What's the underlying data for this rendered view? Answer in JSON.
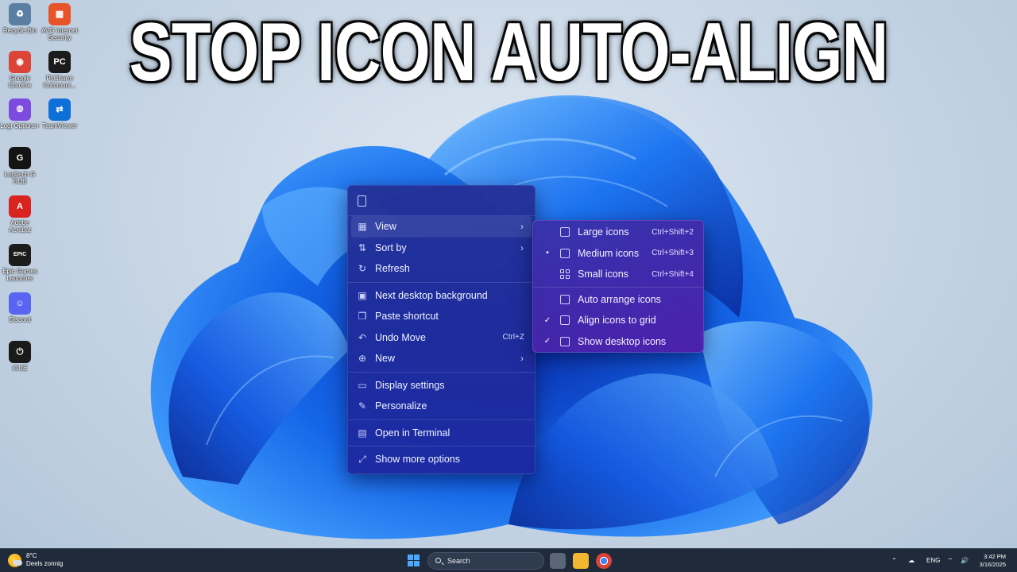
{
  "headline": "STOP ICON AUTO-ALIGN",
  "desktop_icons": [
    {
      "label": "Recycle Bin",
      "glyph": "♻",
      "color": "#5b7fa3"
    },
    {
      "label": "AVG Internet Security",
      "glyph": "▦",
      "color": "#e8542a"
    },
    {
      "label": "Google Chrome",
      "glyph": "◉",
      "color": "#db4437"
    },
    {
      "label": "PyCharm Communi...",
      "glyph": "PC",
      "color": "#1b1b1b"
    },
    {
      "label": "Logi Options+",
      "glyph": "⦾",
      "color": "#7d4be0"
    },
    {
      "label": "TeamViewer",
      "glyph": "⇄",
      "color": "#0e6fd8"
    },
    {
      "label": "Logitech G HUB",
      "glyph": "G",
      "color": "#141414"
    },
    {
      "label": "Adobe Acrobat",
      "glyph": "A",
      "color": "#d8231f"
    },
    {
      "label": "Epic Games Launcher",
      "glyph": "EPIC",
      "color": "#1c1c1c"
    },
    {
      "label": "Discord",
      "glyph": "☺",
      "color": "#5865f2"
    },
    {
      "label": "iCUE",
      "glyph": "⏻",
      "color": "#1a1a1a"
    }
  ],
  "context_menu": {
    "items": [
      {
        "label": "View",
        "icon": "grid-icon",
        "glyph": "▦",
        "arrow": "›",
        "hover": true
      },
      {
        "label": "Sort by",
        "icon": "sort-icon",
        "glyph": "⇅",
        "arrow": "›"
      },
      {
        "label": "Refresh",
        "icon": "refresh-icon",
        "glyph": "↻"
      },
      {
        "sep": true
      },
      {
        "label": "Next desktop background",
        "icon": "wallpaper-icon",
        "glyph": "▣"
      },
      {
        "label": "Paste shortcut",
        "icon": "paste-icon",
        "glyph": "❐"
      },
      {
        "label": "Undo Move",
        "icon": "undo-icon",
        "glyph": "↶",
        "shortcut": "Ctrl+Z"
      },
      {
        "label": "New",
        "icon": "new-icon",
        "glyph": "⊕",
        "arrow": "›"
      },
      {
        "sep": true
      },
      {
        "label": "Display settings",
        "icon": "display-icon",
        "glyph": "▭"
      },
      {
        "label": "Personalize",
        "icon": "brush-icon",
        "glyph": "✎"
      },
      {
        "sep": true
      },
      {
        "label": "Open in Terminal",
        "icon": "terminal-icon",
        "glyph": "▤"
      },
      {
        "sep": true
      },
      {
        "label": "Show more options",
        "icon": "more-options-icon",
        "glyph": "⤢"
      }
    ]
  },
  "view_submenu": {
    "items": [
      {
        "label": "Large icons",
        "shortcut": "Ctrl+Shift+2",
        "mark": "",
        "icon": "large-icons-icon"
      },
      {
        "label": "Medium icons",
        "shortcut": "Ctrl+Shift+3",
        "mark": "•",
        "icon": "medium-icons-icon"
      },
      {
        "label": "Small icons",
        "shortcut": "Ctrl+Shift+4",
        "mark": "",
        "icon": "small-icons-icon"
      },
      {
        "sep": true
      },
      {
        "label": "Auto arrange icons",
        "shortcut": "",
        "mark": "",
        "icon": "auto-arrange-icon"
      },
      {
        "label": "Align icons to grid",
        "shortcut": "",
        "mark": "✓",
        "icon": "align-grid-icon"
      },
      {
        "label": "Show desktop icons",
        "shortcut": "",
        "mark": "✓",
        "icon": "show-desktop-icon"
      }
    ]
  },
  "taskbar": {
    "weather_temp": "8°C",
    "weather_desc": "Deels zonnig",
    "search_label": "Search",
    "language": "ENG",
    "time": "3:42 PM",
    "date": "3/16/2025"
  }
}
